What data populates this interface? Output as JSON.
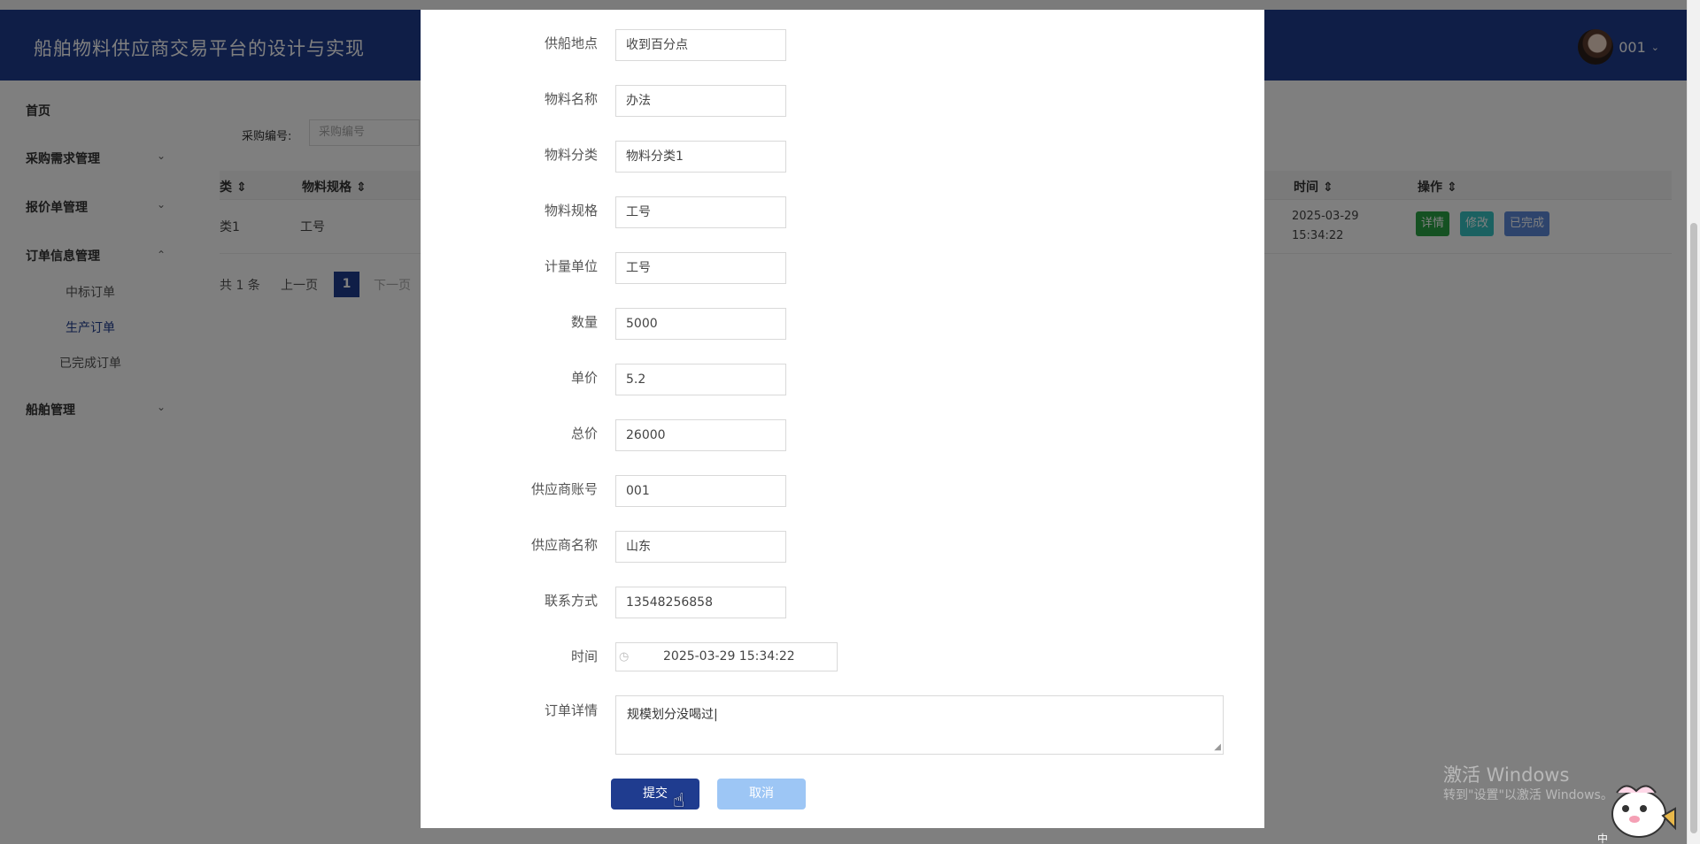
{
  "header": {
    "title": "船舶物料供应商交易平台的设计与实现",
    "username": "001"
  },
  "sidebar": {
    "items": [
      {
        "label": "首页"
      },
      {
        "label": "采购需求管理"
      },
      {
        "label": "报价单管理"
      },
      {
        "label": "订单信息管理"
      },
      {
        "label": "船舶管理"
      }
    ],
    "order_sub": [
      "中标订单",
      "生产订单",
      "已完成订单"
    ],
    "active_sub": "生产订单"
  },
  "main": {
    "search_label": "采购编号:",
    "search_placeholder": "采购编号",
    "columns": [
      "类",
      "物料规格",
      "时间",
      "操作"
    ],
    "row": {
      "col0": "类1",
      "spec": "工号",
      "time": "2025-03-29 15:34:22",
      "actions": [
        "详情",
        "修改",
        "已完成"
      ]
    },
    "pager": {
      "total": "共 1 条",
      "prev": "上一页",
      "page": "1",
      "next": "下一页"
    }
  },
  "form": {
    "fields": [
      {
        "label": "供船地点",
        "value": "收到百分点"
      },
      {
        "label": "物料名称",
        "value": "办法"
      },
      {
        "label": "物料分类",
        "value": "物料分类1"
      },
      {
        "label": "物料规格",
        "value": "工号"
      },
      {
        "label": "计量单位",
        "value": "工号"
      },
      {
        "label": "数量",
        "value": "5000"
      },
      {
        "label": "单价",
        "value": "5.2"
      },
      {
        "label": "总价",
        "value": "26000"
      },
      {
        "label": "供应商账号",
        "value": "001"
      },
      {
        "label": "供应商名称",
        "value": "山东"
      },
      {
        "label": "联系方式",
        "value": "13548256858"
      }
    ],
    "time_label": "时间",
    "time_value": "2025-03-29 15:34:22",
    "detail_label": "订单详情",
    "detail_value": "规模划分没喝过",
    "submit": "提交",
    "cancel": "取消"
  },
  "watermark": {
    "line1": "激活 Windows",
    "line2": "转到\"设置\"以激活 Windows。"
  },
  "colors": {
    "primary": "#1f3c8f",
    "cancel": "#9dc6f5",
    "detail_btn": "#2ba245",
    "edit_btn": "#37c3c3",
    "done_btn": "#5c89d8"
  }
}
